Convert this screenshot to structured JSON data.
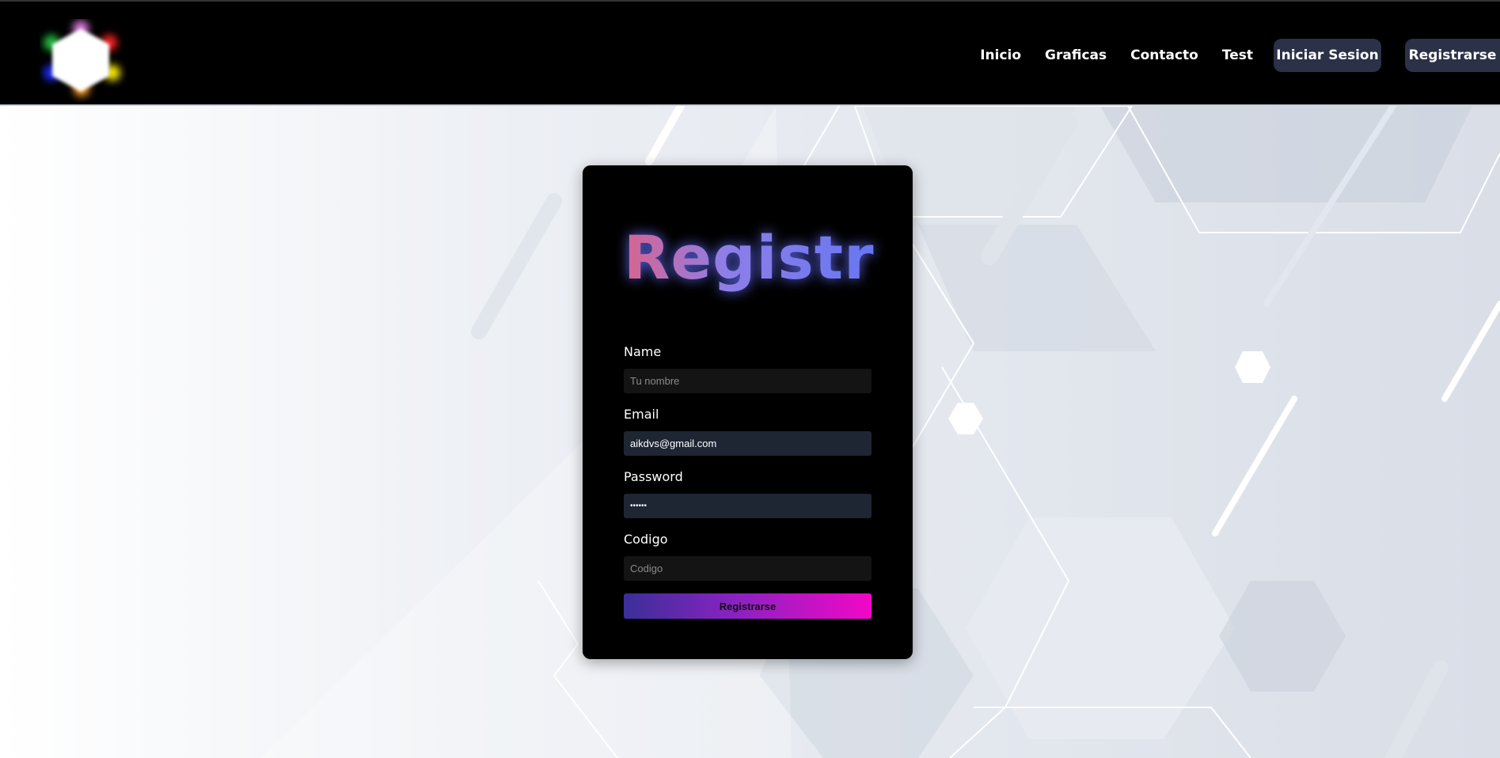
{
  "nav": {
    "links": [
      "Inicio",
      "Graficas",
      "Contacto",
      "Test"
    ],
    "login_label": "Iniciar Sesion",
    "register_label": "Registrarse"
  },
  "form": {
    "title": "Registro",
    "name": {
      "label": "Name",
      "placeholder": "Tu nombre",
      "value": ""
    },
    "email": {
      "label": "Email",
      "placeholder": "",
      "value": "aikdvs@gmail.com"
    },
    "password": {
      "label": "Password",
      "value": "••••••"
    },
    "codigo": {
      "label": "Codigo",
      "placeholder": "Codigo",
      "value": ""
    },
    "submit_label": "Registrarse"
  },
  "colors": {
    "nav_bg": "#000000",
    "button_bg": "#2b3147",
    "card_bg": "#000000",
    "submit_gradient_start": "#3a2f98",
    "submit_gradient_end": "#f207c6"
  },
  "icons": {
    "logo": "hexagon-logo-icon"
  }
}
